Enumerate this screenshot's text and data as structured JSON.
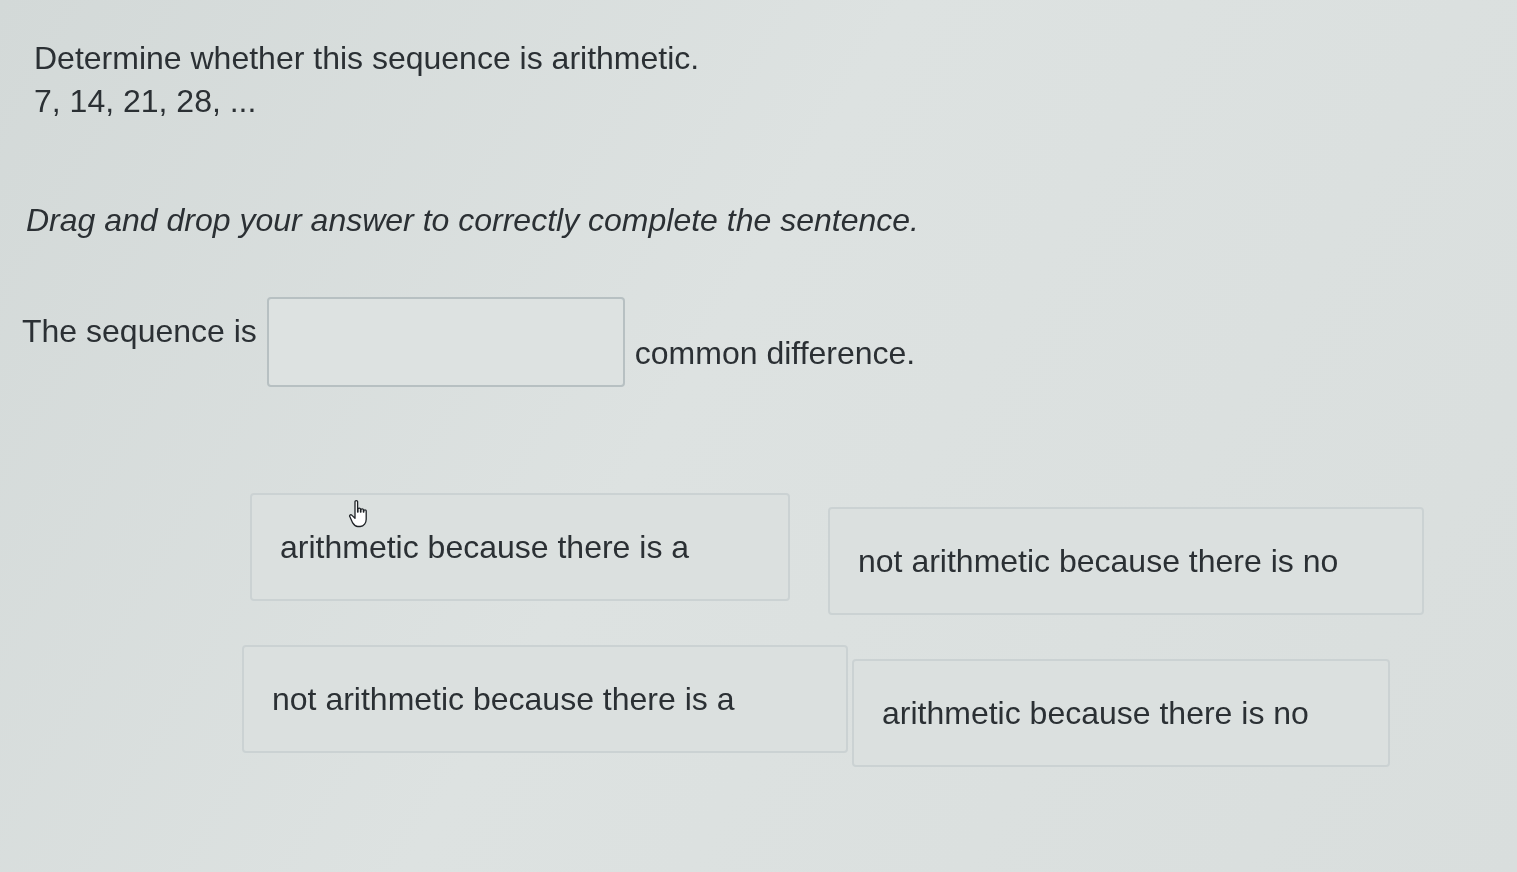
{
  "question": {
    "prompt": "Determine whether this sequence is arithmetic.",
    "sequence": "7, 14, 21, 28, ..."
  },
  "instruction": "Drag and drop your answer to correctly complete the sentence.",
  "sentence": {
    "before": "The sequence is",
    "after": "common difference."
  },
  "choices": [
    {
      "label": "arithmetic because there is a",
      "hovered": true
    },
    {
      "label": "not arithmetic because there is no",
      "hovered": false
    },
    {
      "label": "not arithmetic because there is a",
      "hovered": false
    },
    {
      "label": "arithmetic because there is no",
      "hovered": false
    }
  ]
}
